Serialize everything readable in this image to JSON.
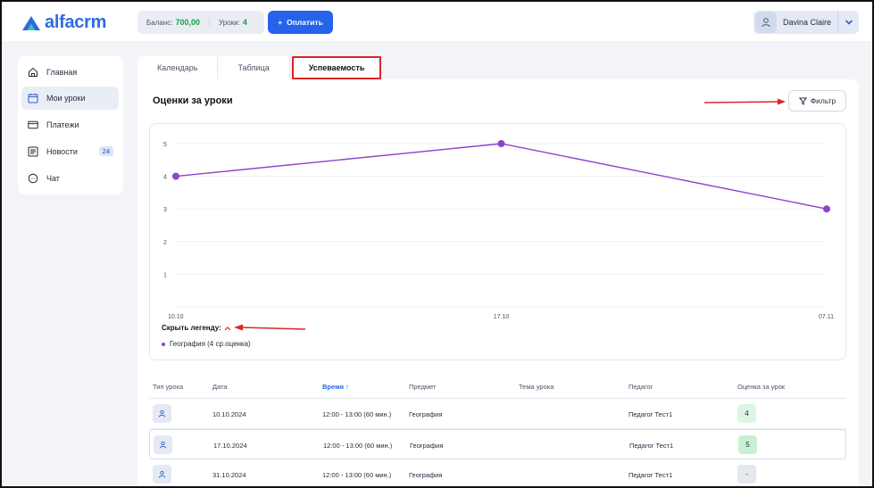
{
  "app": {
    "logo_text": "alfacrm"
  },
  "header": {
    "balance_label": "Баланс:",
    "balance_value": "700,00",
    "lessons_label": "Уроки:",
    "lessons_value": "4",
    "pay_button": "Оплатить",
    "user_name": "Davina Claire"
  },
  "sidebar": {
    "items": [
      {
        "label": "Главная",
        "icon": "home-icon"
      },
      {
        "label": "Мои уроки",
        "icon": "calendar-icon",
        "active": true
      },
      {
        "label": "Платежи",
        "icon": "card-icon"
      },
      {
        "label": "Новости",
        "icon": "news-icon",
        "badge": "24"
      },
      {
        "label": "Чат",
        "icon": "chat-icon"
      }
    ]
  },
  "tabs": [
    {
      "label": "Календарь"
    },
    {
      "label": "Таблица"
    },
    {
      "label": "Успеваемость",
      "active": true
    }
  ],
  "card": {
    "title": "Оценки за уроки",
    "filter_button": "Фильтр",
    "legend_toggle": "Скрыть легенду:",
    "legend_item": "География (4 ср.оценка)"
  },
  "chart_data": {
    "type": "line",
    "x": [
      "10.10",
      "17.10",
      "07.11"
    ],
    "series": [
      {
        "name": "География (4 ср.оценка)",
        "values": [
          4,
          5,
          3
        ],
        "color": "#8e44c8"
      }
    ],
    "yticks": [
      1,
      2,
      3,
      4,
      5
    ],
    "ylim": [
      0,
      5
    ],
    "grid": true
  },
  "table": {
    "headers": [
      "Тип урока",
      "Дата",
      "Время ↑",
      "Предмет",
      "Тема урока",
      "Педагог",
      "Оценка за урок"
    ],
    "rows": [
      {
        "date": "10.10.2024",
        "time": "12:00 - 13:00 (60 мин.)",
        "subject": "География",
        "topic": "",
        "teacher": "Педагог Тест1",
        "grade": "4"
      },
      {
        "date": "17.10.2024",
        "time": "12:00 - 13:00 (60 мин.)",
        "subject": "География",
        "topic": "",
        "teacher": "Педагог Тест1",
        "grade": "5"
      },
      {
        "date": "31.10.2024",
        "time": "12:00 - 13:00 (60 мин.)",
        "subject": "География",
        "topic": "",
        "teacher": "Педагог Тест1",
        "grade": "-"
      }
    ]
  },
  "colors": {
    "accent": "#2563eb",
    "line": "#8e44c8",
    "annotation": "#dc2626"
  }
}
